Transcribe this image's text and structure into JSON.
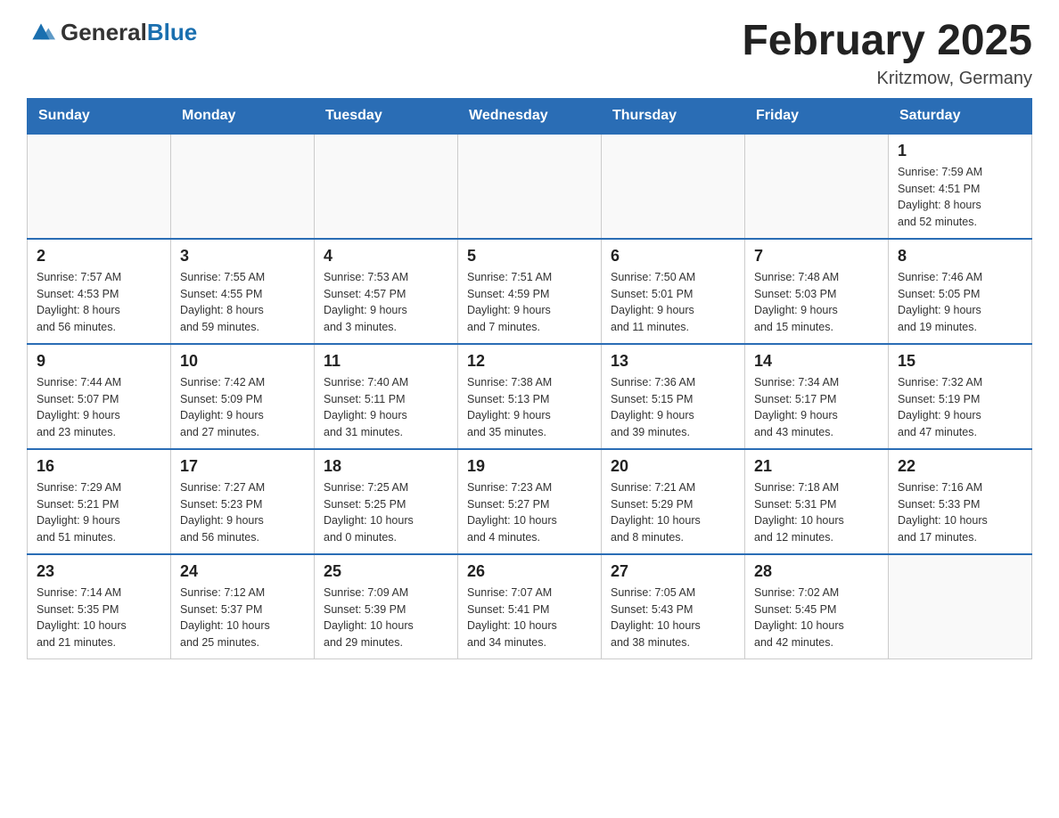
{
  "logo": {
    "general": "General",
    "blue": "Blue"
  },
  "title": "February 2025",
  "subtitle": "Kritzmow, Germany",
  "days_of_week": [
    "Sunday",
    "Monday",
    "Tuesday",
    "Wednesday",
    "Thursday",
    "Friday",
    "Saturday"
  ],
  "weeks": [
    [
      {
        "day": "",
        "info": ""
      },
      {
        "day": "",
        "info": ""
      },
      {
        "day": "",
        "info": ""
      },
      {
        "day": "",
        "info": ""
      },
      {
        "day": "",
        "info": ""
      },
      {
        "day": "",
        "info": ""
      },
      {
        "day": "1",
        "info": "Sunrise: 7:59 AM\nSunset: 4:51 PM\nDaylight: 8 hours\nand 52 minutes."
      }
    ],
    [
      {
        "day": "2",
        "info": "Sunrise: 7:57 AM\nSunset: 4:53 PM\nDaylight: 8 hours\nand 56 minutes."
      },
      {
        "day": "3",
        "info": "Sunrise: 7:55 AM\nSunset: 4:55 PM\nDaylight: 8 hours\nand 59 minutes."
      },
      {
        "day": "4",
        "info": "Sunrise: 7:53 AM\nSunset: 4:57 PM\nDaylight: 9 hours\nand 3 minutes."
      },
      {
        "day": "5",
        "info": "Sunrise: 7:51 AM\nSunset: 4:59 PM\nDaylight: 9 hours\nand 7 minutes."
      },
      {
        "day": "6",
        "info": "Sunrise: 7:50 AM\nSunset: 5:01 PM\nDaylight: 9 hours\nand 11 minutes."
      },
      {
        "day": "7",
        "info": "Sunrise: 7:48 AM\nSunset: 5:03 PM\nDaylight: 9 hours\nand 15 minutes."
      },
      {
        "day": "8",
        "info": "Sunrise: 7:46 AM\nSunset: 5:05 PM\nDaylight: 9 hours\nand 19 minutes."
      }
    ],
    [
      {
        "day": "9",
        "info": "Sunrise: 7:44 AM\nSunset: 5:07 PM\nDaylight: 9 hours\nand 23 minutes."
      },
      {
        "day": "10",
        "info": "Sunrise: 7:42 AM\nSunset: 5:09 PM\nDaylight: 9 hours\nand 27 minutes."
      },
      {
        "day": "11",
        "info": "Sunrise: 7:40 AM\nSunset: 5:11 PM\nDaylight: 9 hours\nand 31 minutes."
      },
      {
        "day": "12",
        "info": "Sunrise: 7:38 AM\nSunset: 5:13 PM\nDaylight: 9 hours\nand 35 minutes."
      },
      {
        "day": "13",
        "info": "Sunrise: 7:36 AM\nSunset: 5:15 PM\nDaylight: 9 hours\nand 39 minutes."
      },
      {
        "day": "14",
        "info": "Sunrise: 7:34 AM\nSunset: 5:17 PM\nDaylight: 9 hours\nand 43 minutes."
      },
      {
        "day": "15",
        "info": "Sunrise: 7:32 AM\nSunset: 5:19 PM\nDaylight: 9 hours\nand 47 minutes."
      }
    ],
    [
      {
        "day": "16",
        "info": "Sunrise: 7:29 AM\nSunset: 5:21 PM\nDaylight: 9 hours\nand 51 minutes."
      },
      {
        "day": "17",
        "info": "Sunrise: 7:27 AM\nSunset: 5:23 PM\nDaylight: 9 hours\nand 56 minutes."
      },
      {
        "day": "18",
        "info": "Sunrise: 7:25 AM\nSunset: 5:25 PM\nDaylight: 10 hours\nand 0 minutes."
      },
      {
        "day": "19",
        "info": "Sunrise: 7:23 AM\nSunset: 5:27 PM\nDaylight: 10 hours\nand 4 minutes."
      },
      {
        "day": "20",
        "info": "Sunrise: 7:21 AM\nSunset: 5:29 PM\nDaylight: 10 hours\nand 8 minutes."
      },
      {
        "day": "21",
        "info": "Sunrise: 7:18 AM\nSunset: 5:31 PM\nDaylight: 10 hours\nand 12 minutes."
      },
      {
        "day": "22",
        "info": "Sunrise: 7:16 AM\nSunset: 5:33 PM\nDaylight: 10 hours\nand 17 minutes."
      }
    ],
    [
      {
        "day": "23",
        "info": "Sunrise: 7:14 AM\nSunset: 5:35 PM\nDaylight: 10 hours\nand 21 minutes."
      },
      {
        "day": "24",
        "info": "Sunrise: 7:12 AM\nSunset: 5:37 PM\nDaylight: 10 hours\nand 25 minutes."
      },
      {
        "day": "25",
        "info": "Sunrise: 7:09 AM\nSunset: 5:39 PM\nDaylight: 10 hours\nand 29 minutes."
      },
      {
        "day": "26",
        "info": "Sunrise: 7:07 AM\nSunset: 5:41 PM\nDaylight: 10 hours\nand 34 minutes."
      },
      {
        "day": "27",
        "info": "Sunrise: 7:05 AM\nSunset: 5:43 PM\nDaylight: 10 hours\nand 38 minutes."
      },
      {
        "day": "28",
        "info": "Sunrise: 7:02 AM\nSunset: 5:45 PM\nDaylight: 10 hours\nand 42 minutes."
      },
      {
        "day": "",
        "info": ""
      }
    ]
  ]
}
